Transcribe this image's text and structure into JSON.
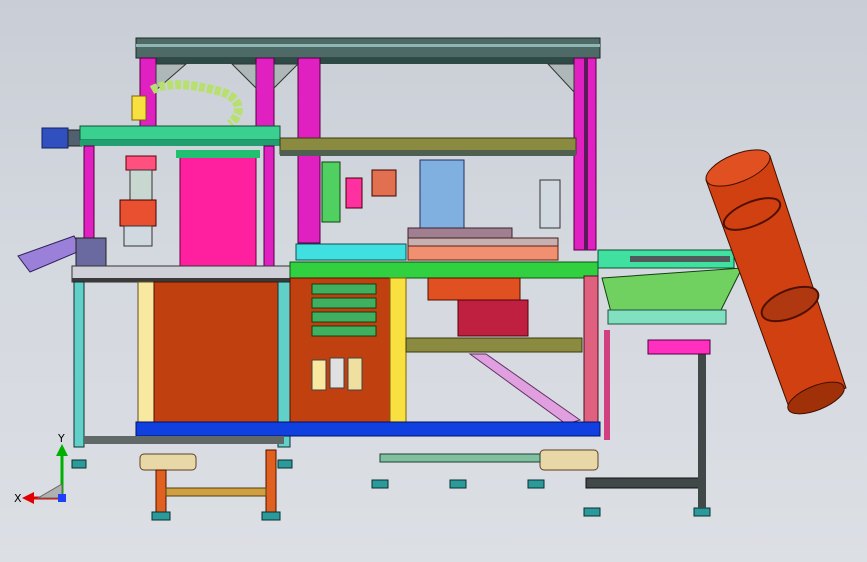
{
  "viewport": {
    "background_top": "#c9ced6",
    "background_bottom": "#dcdfe4"
  },
  "triad": {
    "x_label": "X",
    "y_label": "Y",
    "x_color": "#e00000",
    "y_color": "#00b000",
    "z_color": "#1f3fff"
  },
  "colors": {
    "frame_teal": "#58c8c0",
    "frame_magenta": "#e020c0",
    "frame_green": "#30d040",
    "panel_orange": "#c04010",
    "panel_magenta": "#ff20a0",
    "yellow": "#f8e040",
    "blue": "#1040e0",
    "tube_orange": "#d04010",
    "gray_beam": "#506060"
  }
}
